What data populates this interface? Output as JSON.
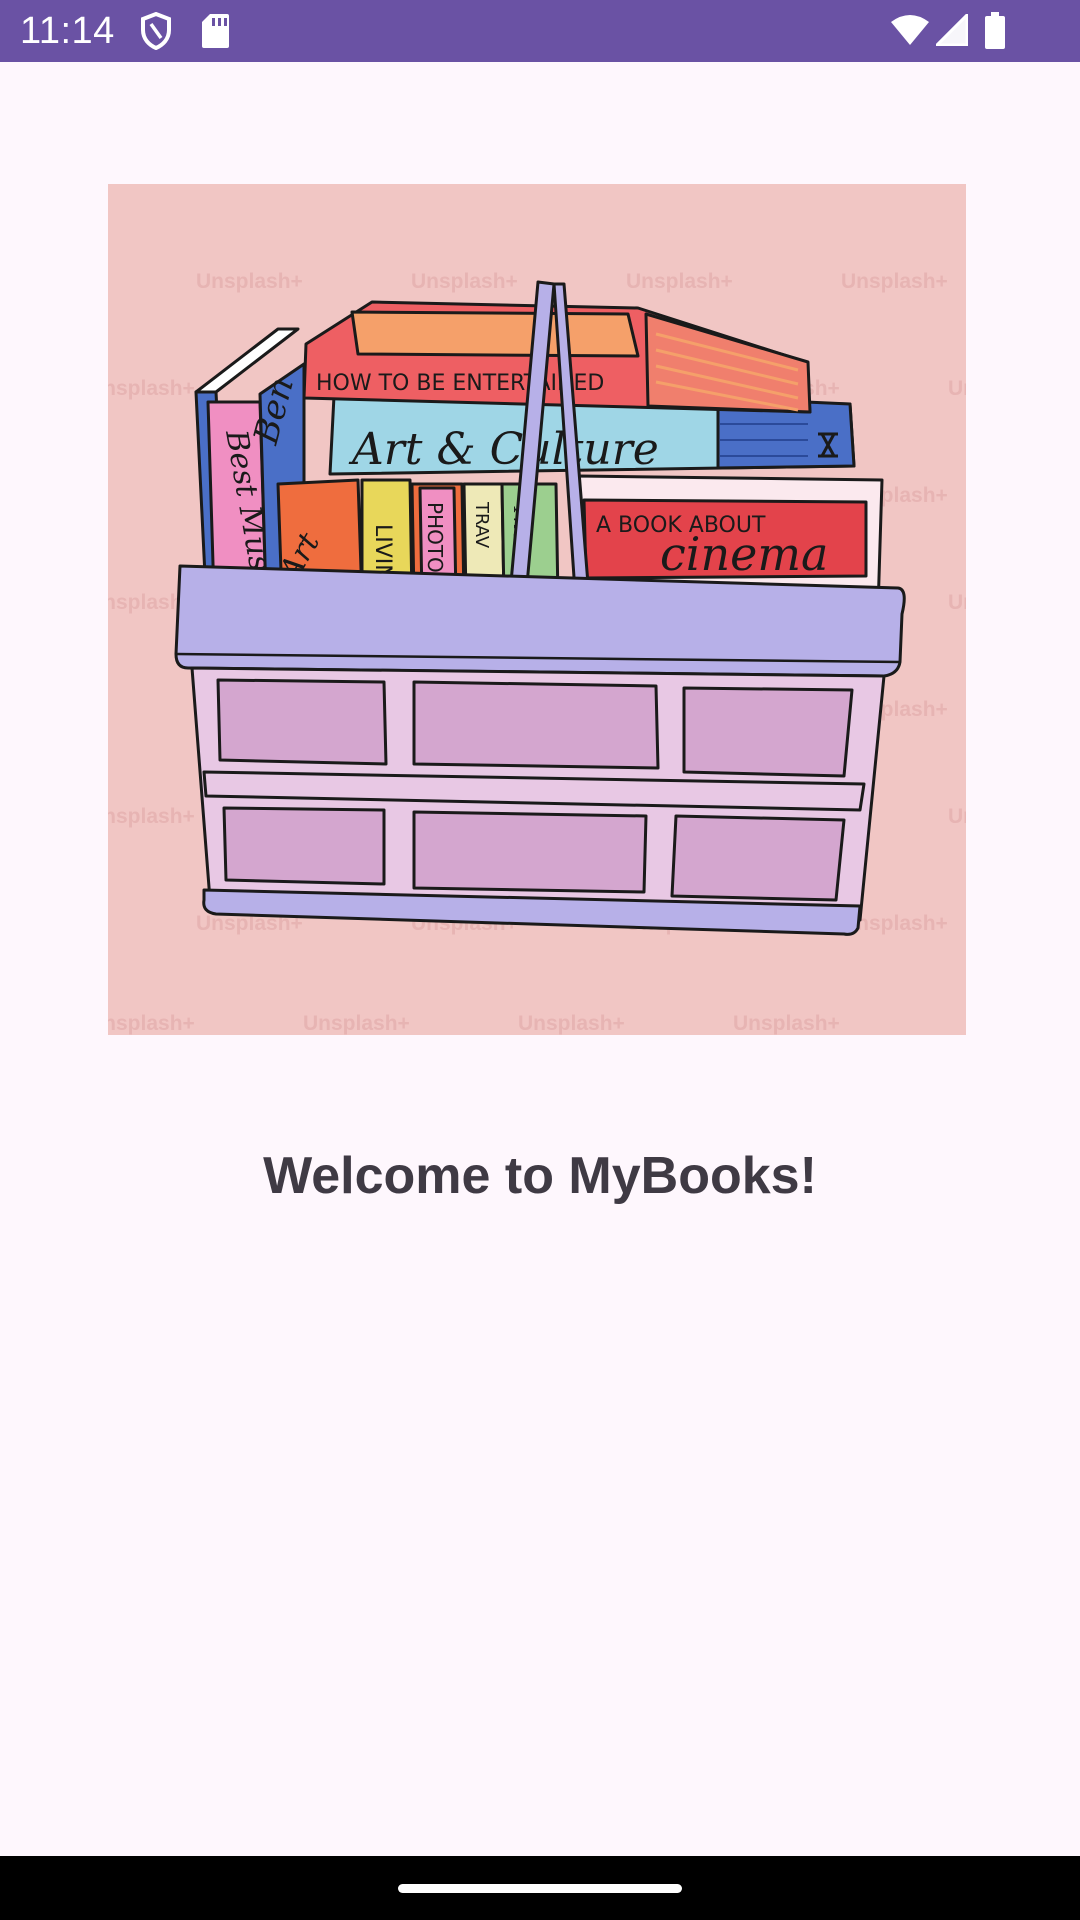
{
  "status_bar": {
    "time": "11:14",
    "background_color": "#6a52a4",
    "left_icons": [
      "shield-icon",
      "sd-card-icon"
    ],
    "right_icons": [
      "wifi-icon",
      "signal-icon",
      "battery-icon"
    ]
  },
  "hero": {
    "icon": "books-in-basket-illustration",
    "background_color": "#f1c6c4",
    "watermark": "Unsplash+",
    "book_titles": {
      "top": "HOW TO BE ENTERTAINED",
      "middle": "Art & Culture",
      "right": "A BOOK ABOUT",
      "right_large": "cinema",
      "spine_pink": "Best Music",
      "spine_blue": "Ben",
      "spine_orange": "Art",
      "spine_yellow": "LIVIN",
      "spine_purple": "PHOTOG",
      "spine_cream": "TRAV",
      "spine_green": "The bu"
    }
  },
  "welcome": {
    "title": "Welcome to MyBooks!"
  },
  "nav_bar": {
    "handle": "home-handle"
  }
}
